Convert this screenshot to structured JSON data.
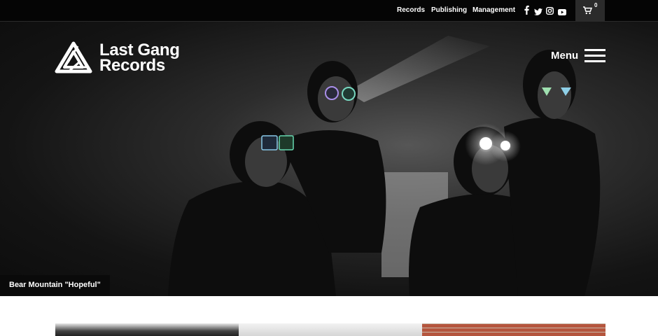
{
  "topbar": {
    "nav": [
      {
        "label": "Records"
      },
      {
        "label": "Publishing"
      },
      {
        "label": "Management"
      }
    ],
    "social_icons": [
      "facebook-icon",
      "twitter-icon",
      "instagram-icon",
      "youtube-icon"
    ],
    "cart": {
      "icon": "cart-icon",
      "count": "0"
    }
  },
  "header": {
    "logo_line1": "Last Gang",
    "logo_line2": "Records",
    "menu_label": "Menu",
    "menu_icon": "hamburger-icon"
  },
  "hero": {
    "caption": "Bear Mountain \"Hopeful\""
  },
  "colors": {
    "topbar_bg": "#050505",
    "cart_bg": "#2b2b2b",
    "text": "#ffffff",
    "caption_bg": "#0a0a0a"
  }
}
